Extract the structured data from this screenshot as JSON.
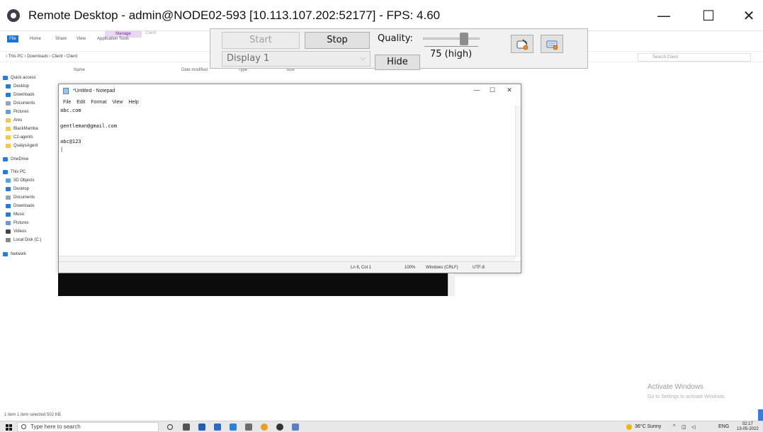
{
  "remote": {
    "title": "Remote Desktop - admin@NODE02-593 [10.113.107.202:52177] - FPS: 4.60",
    "controls": {
      "minimize": "—",
      "maximize": "☐",
      "close": "✕"
    }
  },
  "panel": {
    "start_label": "Start",
    "stop_label": "Stop",
    "display_value": "Display 1",
    "hide_label": "Hide",
    "quality_label": "Quality:",
    "quality_value": "75 (high)",
    "quality_level": 0.75,
    "icons": [
      "mouse-control-icon",
      "keyboard-control-icon"
    ]
  },
  "explorer": {
    "file_tab": "File",
    "tabs": [
      "Home",
      "Share",
      "View",
      "Application Tools"
    ],
    "manage_tab": "Manage",
    "client_tab": "Client",
    "path": "› This PC › Downloads › Client › Client",
    "search_placeholder": "Search Client",
    "columns": [
      "Name",
      "Date modified",
      "Type",
      "Size"
    ],
    "nav": [
      {
        "label": "Quick access",
        "color": "#2b7ad6"
      },
      {
        "label": "Desktop",
        "color": "#2b7ad6"
      },
      {
        "label": "Downloads",
        "color": "#2b7ad6"
      },
      {
        "label": "Documents",
        "color": "#8fa5bf"
      },
      {
        "label": "Pictures",
        "color": "#6b9ad4"
      },
      {
        "label": "Ares",
        "color": "#f2c94c"
      },
      {
        "label": "BlackMamba",
        "color": "#f2c94c"
      },
      {
        "label": "C2-agents",
        "color": "#f2c94c"
      },
      {
        "label": "QualysAgent",
        "color": "#f2c94c"
      },
      {
        "label": "OneDrive",
        "color": "#2b7ad6"
      },
      {
        "label": "This PC",
        "color": "#2b7ad6"
      },
      {
        "label": "3D Objects",
        "color": "#5aa0e0"
      },
      {
        "label": "Desktop",
        "color": "#2b7ad6"
      },
      {
        "label": "Documents",
        "color": "#8fa5bf"
      },
      {
        "label": "Downloads",
        "color": "#2b7ad6"
      },
      {
        "label": "Music",
        "color": "#2b7ad6"
      },
      {
        "label": "Pictures",
        "color": "#6b9ad4"
      },
      {
        "label": "Videos",
        "color": "#444444"
      },
      {
        "label": "Local Disk (C:)",
        "color": "#888888"
      },
      {
        "label": "Network",
        "color": "#2b7ad6"
      }
    ],
    "status": "1 item    1 item selected  502 KB"
  },
  "notepad": {
    "title": "*Untitled - Notepad",
    "menu": [
      "File",
      "Edit",
      "Format",
      "View",
      "Help"
    ],
    "lines": [
      "abc.com",
      "",
      "gentleman@gmail.com",
      "",
      "abc@123",
      "|"
    ],
    "status_pos": "Ln 6, Col 1",
    "status_zoom": "100%",
    "status_eol": "Windows (CRLF)",
    "status_enc": "UTF-8",
    "controls": {
      "minimize": "—",
      "maximize": "☐",
      "close": "✕"
    }
  },
  "watermark": {
    "title": "Activate Windows",
    "sub": "Go to Settings to activate Windows."
  },
  "taskbar": {
    "search_placeholder": "Type here to search",
    "weather": "36°C  Sunny",
    "lang": "ENG",
    "time": "02:17",
    "date": "13-05-2022"
  }
}
